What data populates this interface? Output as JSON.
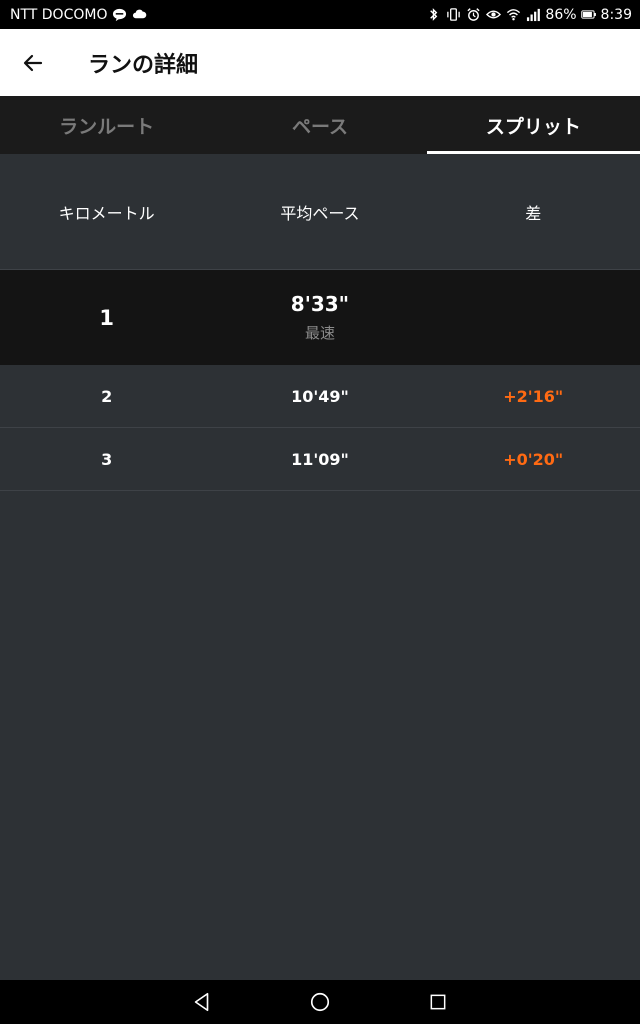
{
  "status_bar": {
    "carrier": "NTT DOCOMO",
    "battery": "86%",
    "time": "8:39"
  },
  "app_bar": {
    "title": "ランの詳細"
  },
  "tabs": [
    {
      "label": "ランルート",
      "active": false
    },
    {
      "label": "ペース",
      "active": false
    },
    {
      "label": "スプリット",
      "active": true
    }
  ],
  "table": {
    "headers": [
      "キロメートル",
      "平均ペース",
      "差"
    ],
    "rows": [
      {
        "km": "1",
        "pace": "8'33\"",
        "note": "最速",
        "diff": ""
      },
      {
        "km": "2",
        "pace": "10'49\"",
        "note": "",
        "diff": "+2'16\""
      },
      {
        "km": "3",
        "pace": "11'09\"",
        "note": "",
        "diff": "+0'20\""
      }
    ]
  },
  "colors": {
    "accent_orange": "#ff6a13",
    "background": "#2d3135",
    "tab_bar": "#1b1b1b",
    "fastest_row": "#141414"
  },
  "icons": [
    "back-arrow-icon",
    "nav-back-icon",
    "nav-home-icon",
    "nav-recents-icon"
  ]
}
